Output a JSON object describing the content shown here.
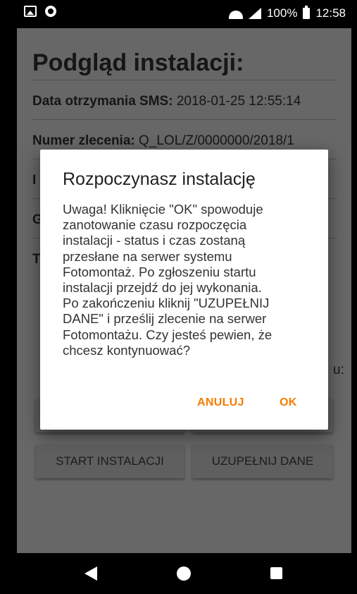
{
  "status_bar": {
    "battery": "100%",
    "time": "12:58"
  },
  "page": {
    "title": "Podgląd instalacji:",
    "sms_label": "Data otrzymania SMS:",
    "sms_value": "2018-01-25 12:55:14",
    "order_label": "Numer zlecenia:",
    "order_value": "Q_LOL/Z/0000000/2018/1",
    "row3_fragment": "I",
    "row4_fragment": "G",
    "row5_fragment": "T",
    "row6_fragment": "u:"
  },
  "buttons": {
    "start": "START INSTALACJI",
    "complete": "UZUPEŁNIJ DANE"
  },
  "dialog": {
    "title": "Rozpoczynasz instalację",
    "message_lines": [
      "Uwaga! Kliknięcie \"OK\" spowoduje",
      "zanotowanie czasu rozpoczęcia",
      "instalacji - status i czas zostaną",
      "przesłane na serwer systemu",
      "Fotomontaż. Po zgłoszeniu startu",
      "instalacji przejdź do jej wykonania.",
      "Po zakończeniu kliknij \"UZUPEŁNIJ",
      "DANE\" i prześlij zlecenie na serwer",
      "Fotomontażu. Czy jesteś pewien, że",
      "chcesz kontynuować?"
    ],
    "cancel": "ANULUJ",
    "ok": "OK"
  },
  "colors": {
    "accent": "#f57c00",
    "scrim_background": "#676767",
    "dialog_background": "#ffffff"
  }
}
